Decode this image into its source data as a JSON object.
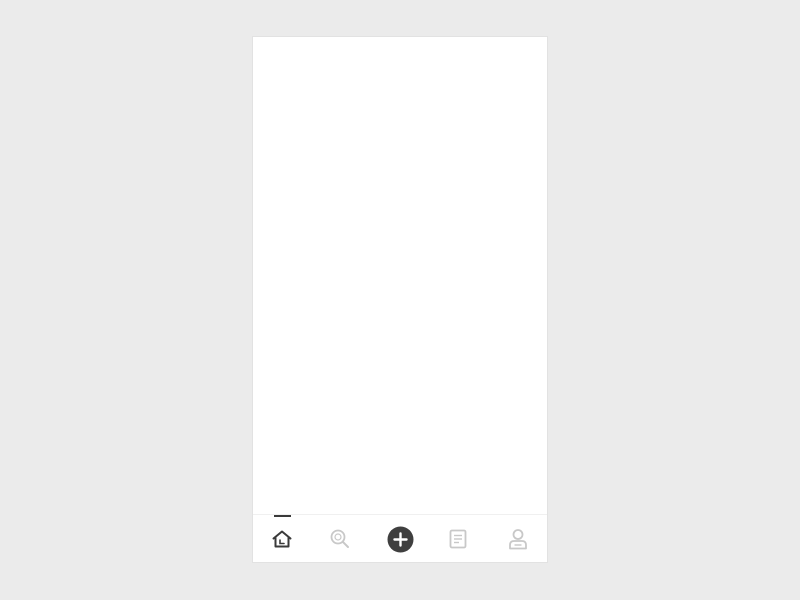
{
  "colors": {
    "background": "#ebebeb",
    "screen": "#ffffff",
    "active": "#3a3a3a",
    "inactive": "#c8c8c8",
    "add_button": "#3f3f3f"
  },
  "tab_bar": {
    "active_tab": "home",
    "tabs": [
      {
        "id": "home",
        "icon": "home-icon",
        "active": true
      },
      {
        "id": "search",
        "icon": "search-icon",
        "active": false
      },
      {
        "id": "add",
        "icon": "plus-circle-icon",
        "active": false
      },
      {
        "id": "notes",
        "icon": "document-icon",
        "active": false
      },
      {
        "id": "profile",
        "icon": "user-icon",
        "active": false
      }
    ]
  }
}
